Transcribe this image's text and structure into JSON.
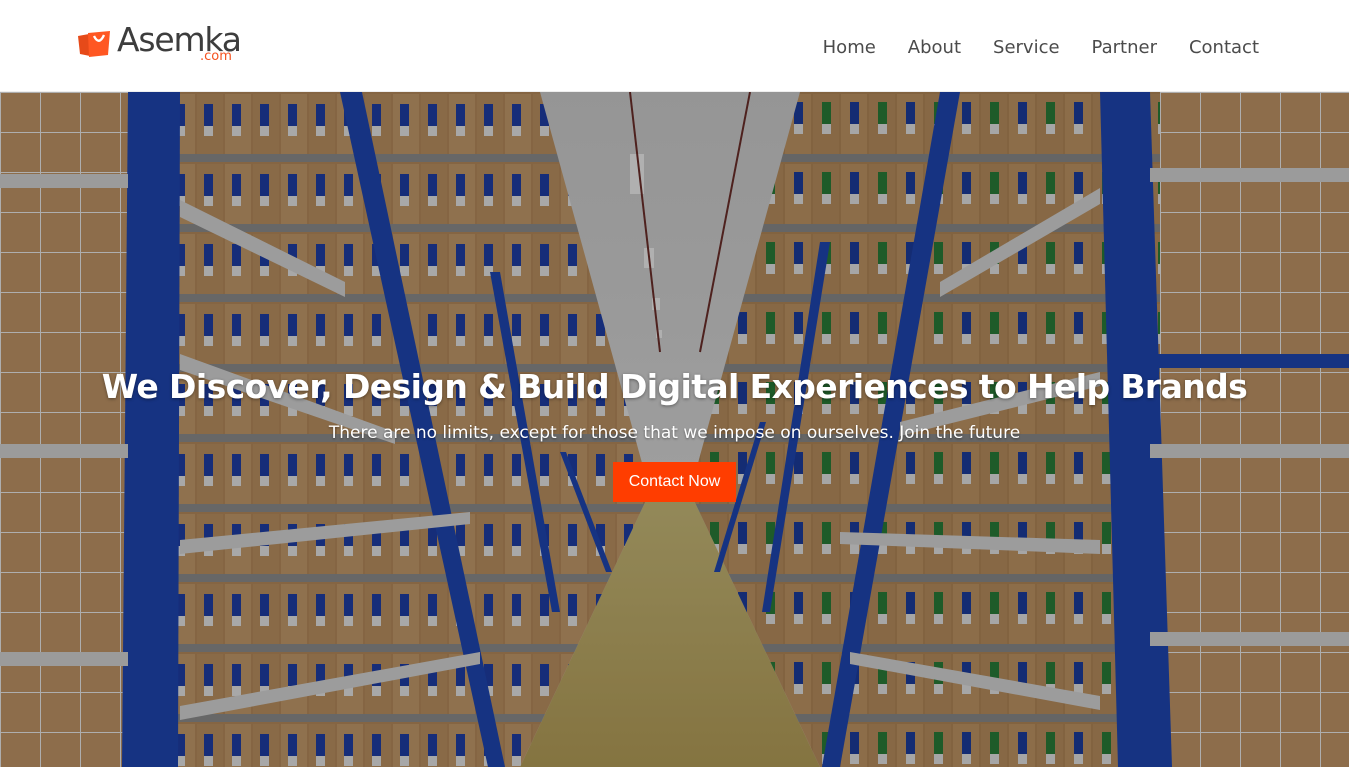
{
  "brand": {
    "name": "Asemka",
    "tld": ".com",
    "accent_color": "#f4511e",
    "logo_icon": "shopping-bag-icon"
  },
  "nav": {
    "items": [
      {
        "label": "Home"
      },
      {
        "label": "About"
      },
      {
        "label": "Service"
      },
      {
        "label": "Partner"
      },
      {
        "label": "Contact"
      }
    ]
  },
  "hero": {
    "title": "We Discover, Design & Build Digital Experiences to Help Brands",
    "subtitle": "There are no limits, except for those that we impose on ourselves. Join the future",
    "cta_label": "Contact Now",
    "cta_color": "#ff3d00",
    "background": "warehouse-shelves-image"
  }
}
